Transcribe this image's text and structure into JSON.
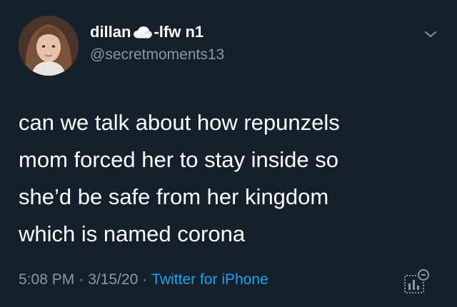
{
  "user": {
    "display_name_before": "dillan",
    "display_name_after": "-lfw n1",
    "emoji": "cloud-icon",
    "handle": "@secretmoments13"
  },
  "tweet": {
    "lines": [
      "can we talk about how repunzels",
      "mom forced her to stay inside so",
      "she’d be safe from her kingdom",
      "which is named corona"
    ]
  },
  "meta": {
    "time": "5:08 PM",
    "date": "3/15/20",
    "separator": "·",
    "source": "Twitter for iPhone"
  },
  "colors": {
    "background": "#15202b",
    "text": "#ffffff",
    "secondary": "#8899a6",
    "link": "#1da1f2"
  }
}
